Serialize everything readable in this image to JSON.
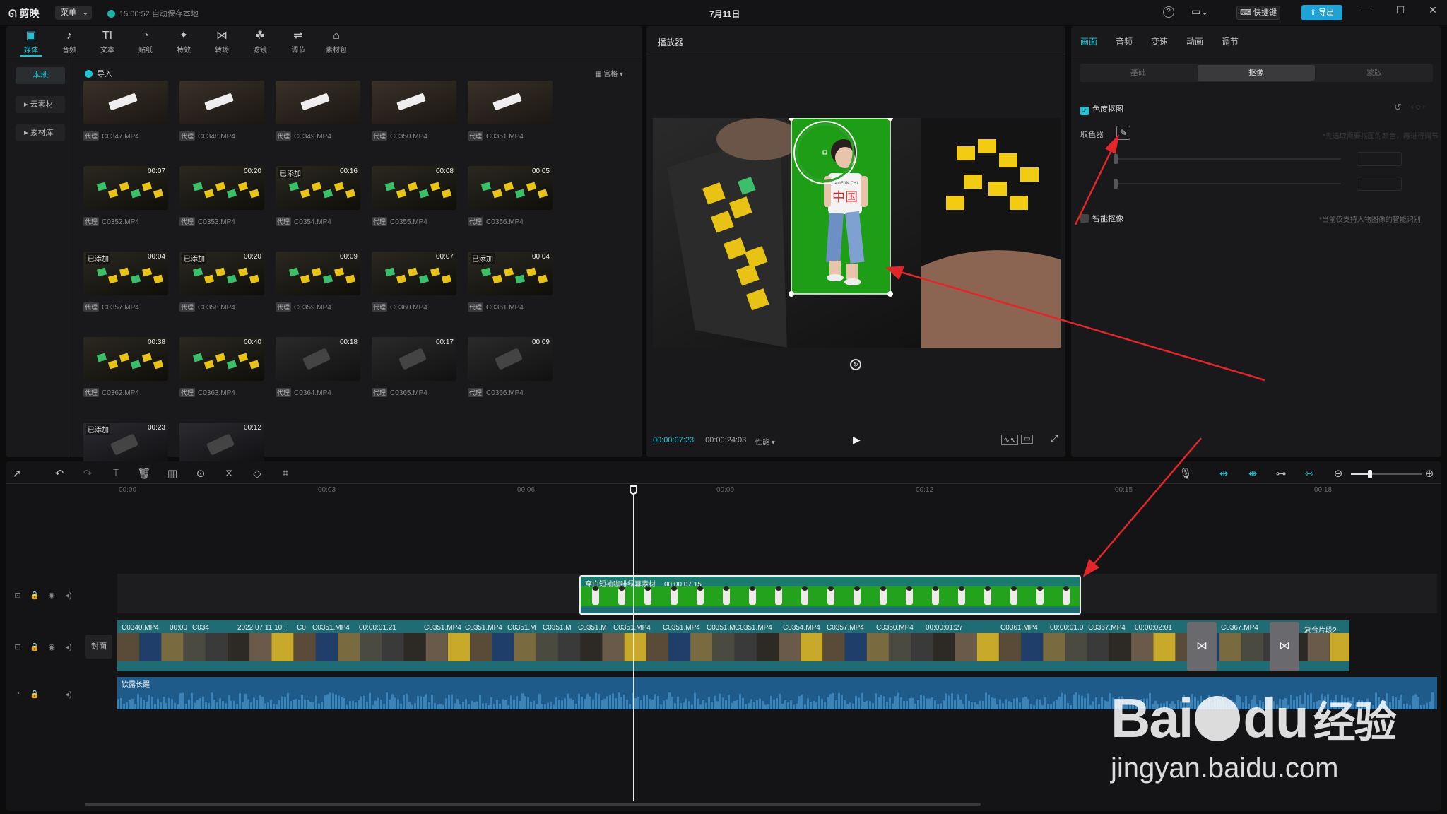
{
  "titlebar": {
    "app_name": "剪映",
    "menu_label": "菜单",
    "autosave": "15:00:52 自动保存本地",
    "title": "7月11日",
    "shortcut_label": "快捷键",
    "export_label": "导出"
  },
  "toolbar": [
    {
      "label": "媒体",
      "icon": "▣"
    },
    {
      "label": "音频",
      "icon": "♪"
    },
    {
      "label": "文本",
      "icon": "TI"
    },
    {
      "label": "贴纸",
      "icon": "◔"
    },
    {
      "label": "特效",
      "icon": "✦"
    },
    {
      "label": "转场",
      "icon": "⋈"
    },
    {
      "label": "滤镜",
      "icon": "☘"
    },
    {
      "label": "调节",
      "icon": "⇌"
    },
    {
      "label": "素材包",
      "icon": "⌂"
    }
  ],
  "media_sidebar": {
    "local": "本地",
    "cloud": "云素材",
    "library": "素材库"
  },
  "media": {
    "import_label": "导入",
    "view_label": "宫格",
    "items": [
      {
        "name": "C0347.MP4",
        "dur": "",
        "added": ""
      },
      {
        "name": "C0348.MP4",
        "dur": "",
        "added": ""
      },
      {
        "name": "C0349.MP4",
        "dur": "",
        "added": ""
      },
      {
        "name": "C0350.MP4",
        "dur": "",
        "added": ""
      },
      {
        "name": "C0351.MP4",
        "dur": "",
        "added": ""
      },
      {
        "name": "C0352.MP4",
        "dur": "00:07",
        "added": ""
      },
      {
        "name": "C0353.MP4",
        "dur": "00:20",
        "added": ""
      },
      {
        "name": "C0354.MP4",
        "dur": "00:16",
        "added": "已添加"
      },
      {
        "name": "C0355.MP4",
        "dur": "00:08",
        "added": ""
      },
      {
        "name": "C0356.MP4",
        "dur": "00:05",
        "added": ""
      },
      {
        "name": "C0357.MP4",
        "dur": "00:04",
        "added": "已添加"
      },
      {
        "name": "C0358.MP4",
        "dur": "00:20",
        "added": "已添加"
      },
      {
        "name": "C0359.MP4",
        "dur": "00:09",
        "added": ""
      },
      {
        "name": "C0360.MP4",
        "dur": "00:07",
        "added": ""
      },
      {
        "name": "C0361.MP4",
        "dur": "00:04",
        "added": "已添加"
      },
      {
        "name": "C0362.MP4",
        "dur": "00:38",
        "added": ""
      },
      {
        "name": "C0363.MP4",
        "dur": "00:40",
        "added": ""
      },
      {
        "name": "C0364.MP4",
        "dur": "00:18",
        "added": ""
      },
      {
        "name": "C0365.MP4",
        "dur": "00:17",
        "added": ""
      },
      {
        "name": "C0366.MP4",
        "dur": "00:09",
        "added": ""
      },
      {
        "name": "",
        "dur": "00:23",
        "added": "已添加"
      },
      {
        "name": "",
        "dur": "00:12",
        "added": ""
      }
    ],
    "tag": "代理"
  },
  "player": {
    "title": "播放器",
    "current": "00:00:07:23",
    "total": "00:00:24:03",
    "perf": "性能",
    "shirt_text": "中国",
    "shirt_small": "MADE IN CHI"
  },
  "props": {
    "tabs": [
      "画面",
      "音频",
      "变速",
      "动画",
      "调节"
    ],
    "subtabs": [
      "基础",
      "抠像",
      "蒙版"
    ],
    "chroma_label": "色度抠图",
    "picker_label": "取色器",
    "picker_hint": "*先选取需要抠图的颜色，再进行调节",
    "smart_label": "智能抠像",
    "smart_hint": "*当前仅支持人物图像的智能识别"
  },
  "timeline": {
    "ruler": [
      "00:00",
      "00:03",
      "00:06",
      "00:09",
      "00:12",
      "00:15",
      "00:18"
    ],
    "overlay_clip": {
      "name": "穿白短袖咖啡绿幕素材",
      "dur": "00:00:07.15"
    },
    "cover_label": "封面",
    "main_labels": [
      "C0340.MP4",
      "00:00",
      "C034",
      "2022 07 11 10 :",
      "C0",
      "C0351.MP4",
      "00:00:01.21",
      "C0351.MP4",
      "C0351.MP4",
      "C0351.M",
      "C0351.M",
      "C0351.M",
      "C0351.MP4",
      "C0351.MP4",
      "C0351.M",
      "C0351.MP4",
      "C0354.MP4",
      "C0357.MP4",
      "C0350.MP4",
      "00:00:01:27",
      "C0361.MP4",
      "00:00:01.0",
      "C0367.MP4",
      "00:00:02:01",
      "C0367.MP4",
      "复合片段2"
    ],
    "audio_label": "饮露长醒"
  },
  "watermark": {
    "brand": "Bai",
    "brand2": "du",
    "cn": "经验",
    "url": "jingyan.baidu.com"
  },
  "colors": {
    "accent": "#1fc3d6",
    "green_screen": "#1e9e16",
    "clip_teal": "#1f6c74",
    "audio_blue": "#1e5a8a",
    "arrow": "#e2262a"
  }
}
